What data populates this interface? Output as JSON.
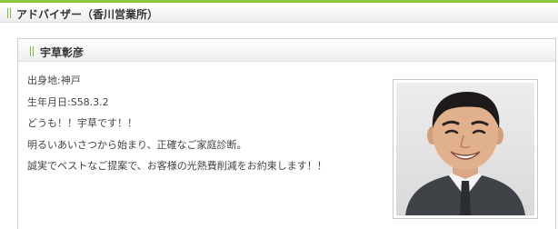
{
  "section": {
    "title": "アドバイザー（香川営業所）"
  },
  "profile": {
    "name": "宇草彰彦",
    "birthplace": "出身地:神戸",
    "birthdate": "生年月日:S58.3.2",
    "greeting": "どうも！！宇草です！！",
    "line1": "明るいあいさつから始まり、正確なご家庭診断。",
    "line2": "誠実でベストなご提案で、お客様の光熱費削減をお約束します！！"
  },
  "colors": {
    "accent": "#8cc63e",
    "border": "#cfcfcf",
    "text": "#333333"
  },
  "icons": {
    "section_grip": "grip-icon",
    "card_grip": "grip-icon"
  }
}
